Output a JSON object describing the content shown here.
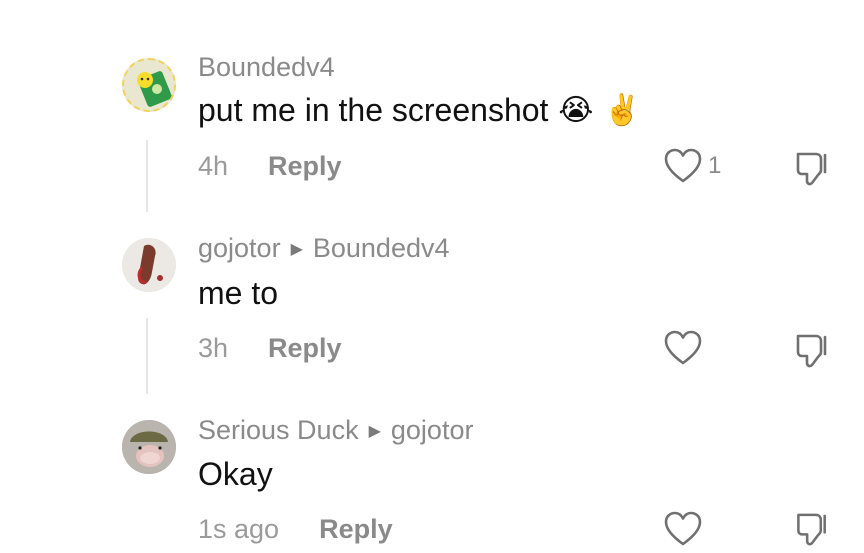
{
  "comments": [
    {
      "username": "Boundedv4",
      "text": "put me in the screenshot",
      "emoji": [
        "😭",
        "✌️"
      ],
      "time": "4h",
      "reply_label": "Reply",
      "likes": "1"
    },
    {
      "username": "gojotor",
      "reply_to": "Boundedv4",
      "text": "me to",
      "time": "3h",
      "reply_label": "Reply"
    },
    {
      "username": "Serious Duck",
      "reply_to": "gojotor",
      "text": "Okay",
      "time": "1s ago",
      "reply_label": "Reply"
    }
  ],
  "icons": {
    "like": "heart-icon",
    "dislike": "thumbs-down-icon",
    "reply_to": "reply-arrow-icon"
  },
  "colors": {
    "username": "#8a8a8a",
    "text": "#111111",
    "meta": "#9a9a9a",
    "icon": "#6f6f6f"
  }
}
